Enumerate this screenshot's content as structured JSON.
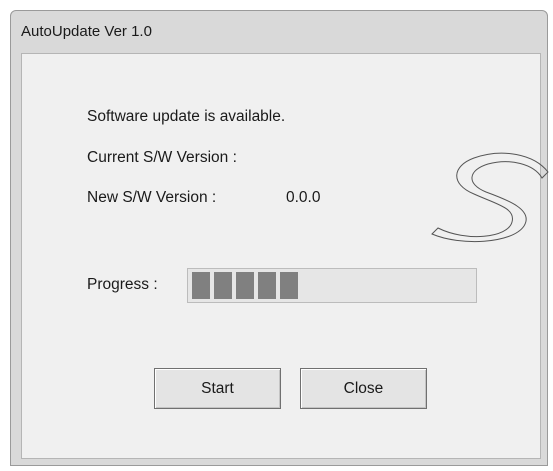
{
  "window": {
    "title": "AutoUpdate Ver 1.0"
  },
  "dialog": {
    "message": "Software update is available.",
    "current_version_label": "Current S/W Version :",
    "current_version_value": "",
    "new_version_label": "New S/W Version :",
    "new_version_value": "0.0.0",
    "progress_label": "Progress :",
    "progress": {
      "filled_segments": 5,
      "fraction": 0.42
    }
  },
  "buttons": {
    "start_label": "Start",
    "close_label": "Close"
  }
}
